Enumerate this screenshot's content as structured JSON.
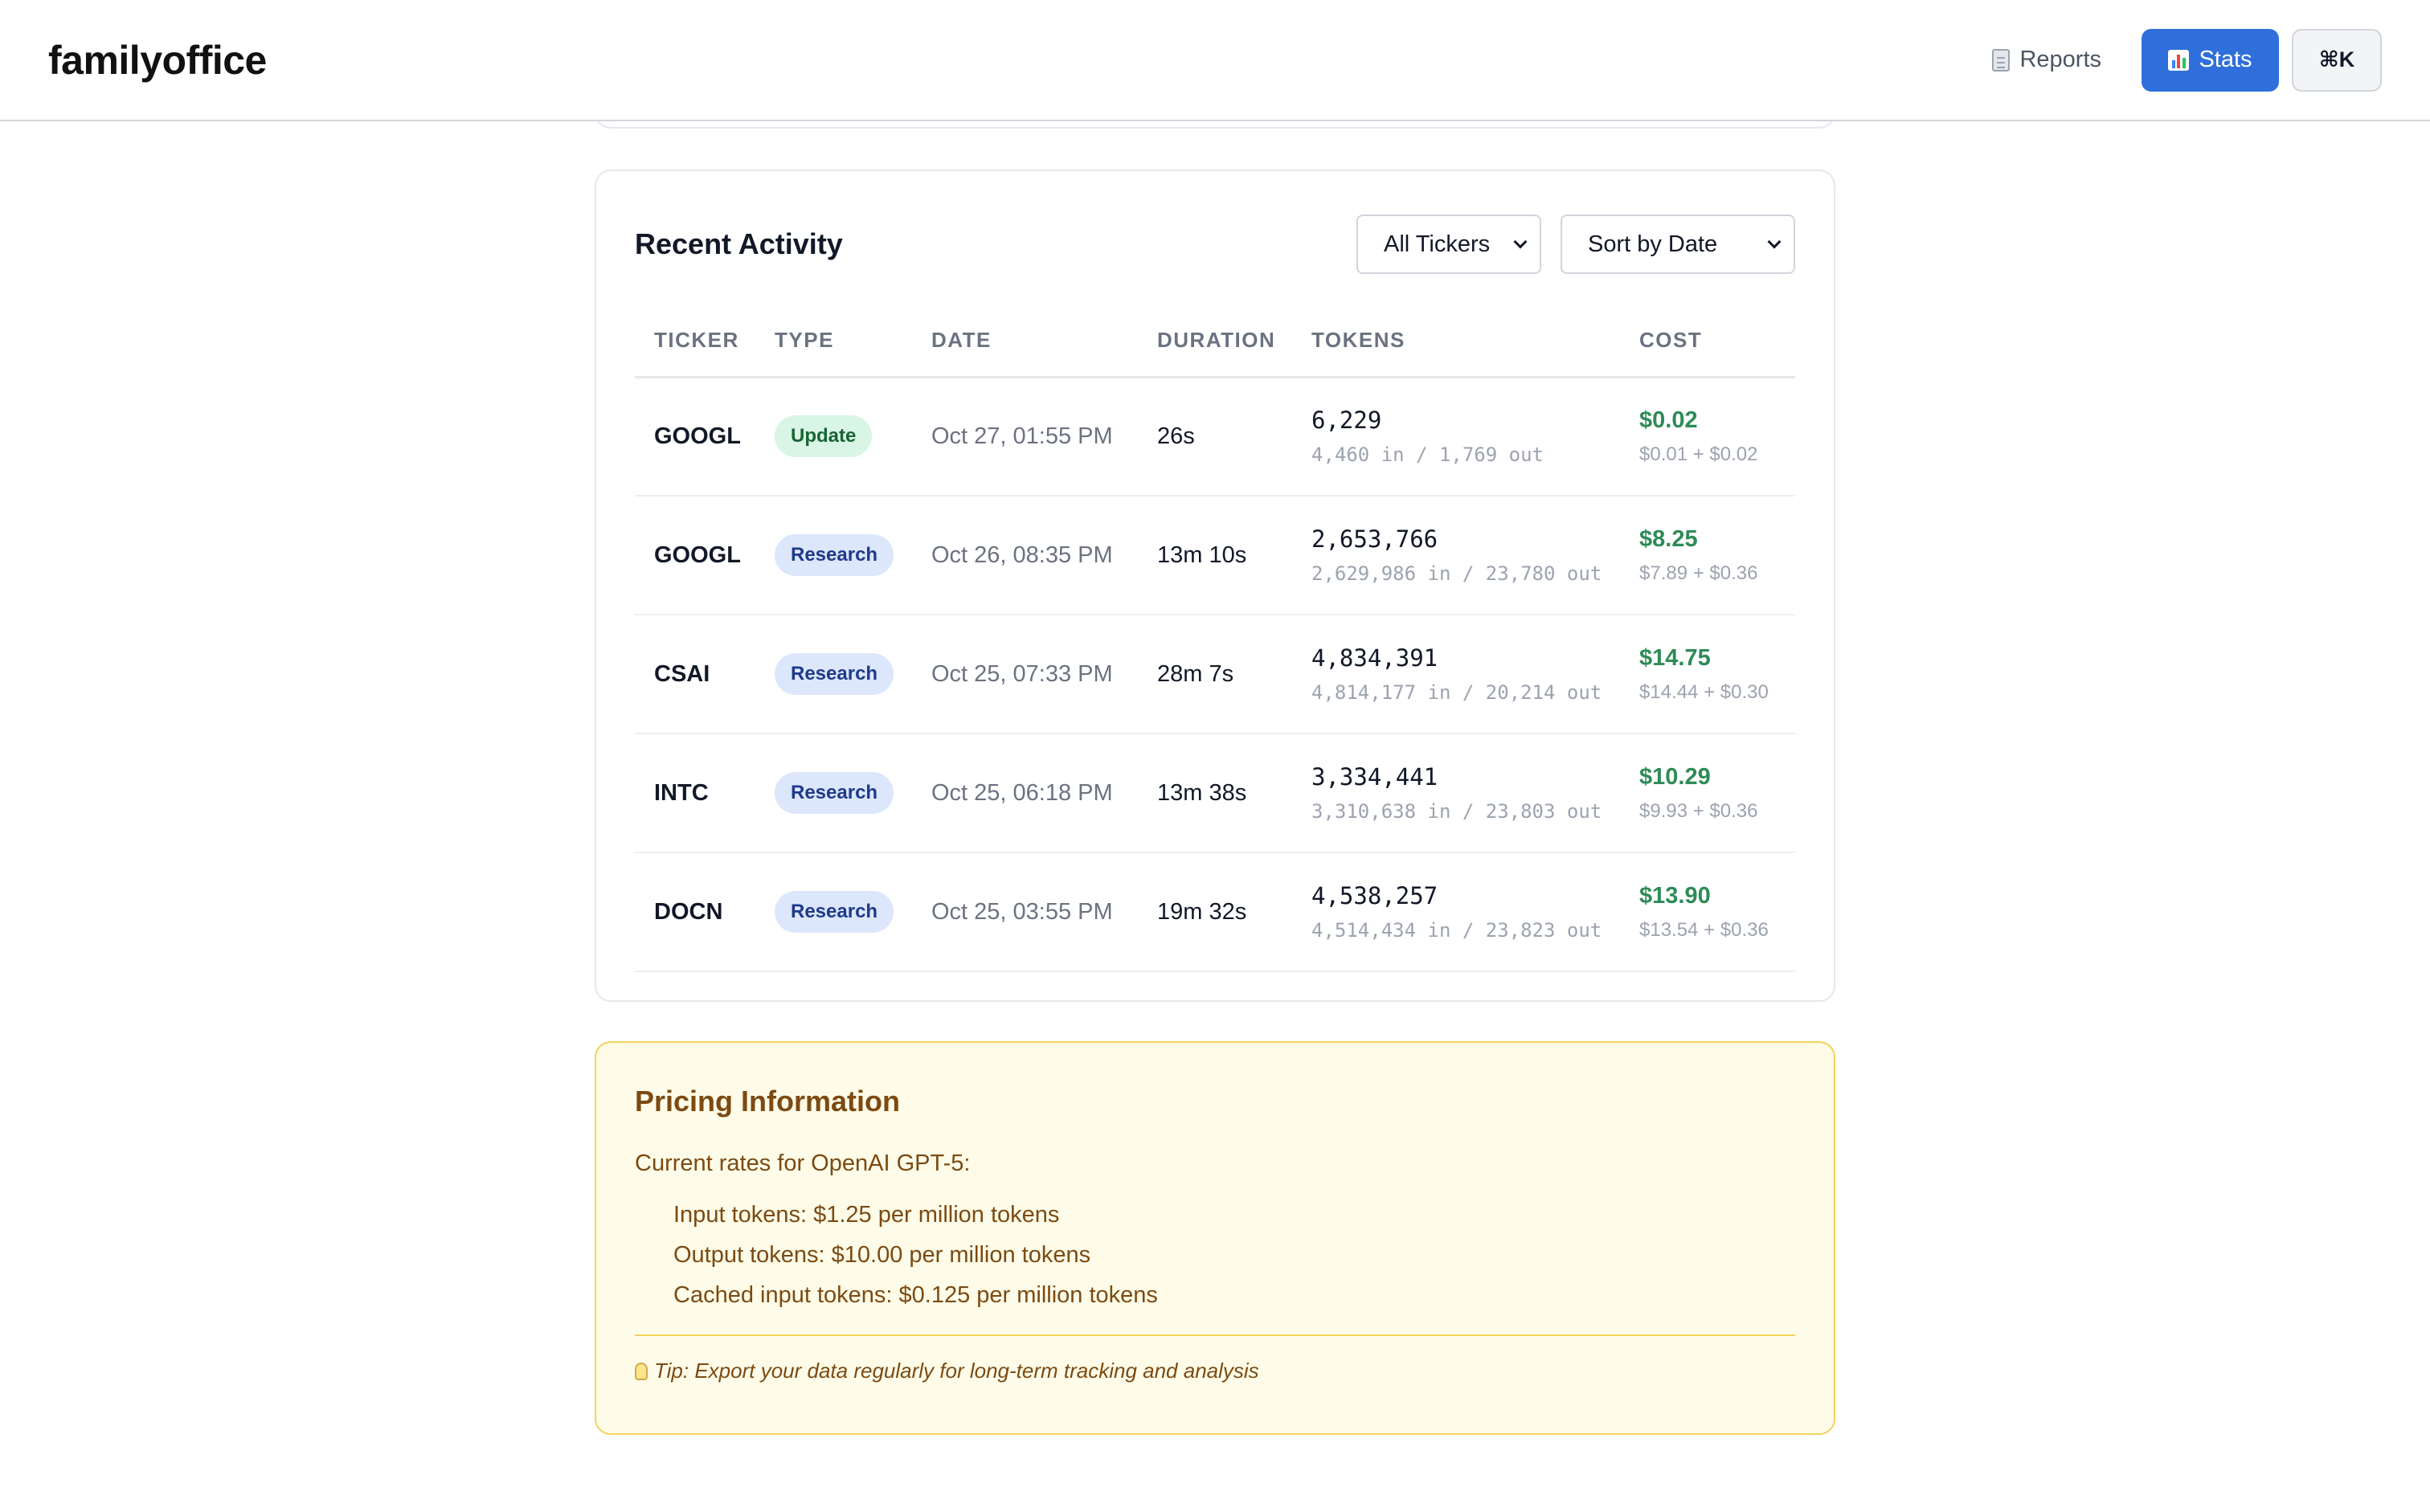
{
  "app": {
    "brand": "familyoffice",
    "nav": {
      "reports_label": "Reports",
      "stats_label": "Stats",
      "shortcut_label": "⌘K"
    }
  },
  "activity": {
    "title": "Recent Activity",
    "filters": {
      "ticker_selected": "All Tickers",
      "sort_selected": "Sort by Date"
    },
    "columns": [
      "TICKER",
      "TYPE",
      "DATE",
      "DURATION",
      "TOKENS",
      "COST"
    ],
    "rows": [
      {
        "ticker": "GOOGL",
        "type": "Update",
        "date": "Oct 27, 01:55 PM",
        "duration": "26s",
        "tokens": "6,229",
        "tokens_detail": "4,460 in / 1,769 out",
        "cost": "$0.02",
        "cost_detail": "$0.01 + $0.02"
      },
      {
        "ticker": "GOOGL",
        "type": "Research",
        "date": "Oct 26, 08:35 PM",
        "duration": "13m 10s",
        "tokens": "2,653,766",
        "tokens_detail": "2,629,986 in / 23,780 out",
        "cost": "$8.25",
        "cost_detail": "$7.89 + $0.36"
      },
      {
        "ticker": "CSAI",
        "type": "Research",
        "date": "Oct 25, 07:33 PM",
        "duration": "28m 7s",
        "tokens": "4,834,391",
        "tokens_detail": "4,814,177 in / 20,214 out",
        "cost": "$14.75",
        "cost_detail": "$14.44 + $0.30"
      },
      {
        "ticker": "INTC",
        "type": "Research",
        "date": "Oct 25, 06:18 PM",
        "duration": "13m 38s",
        "tokens": "3,334,441",
        "tokens_detail": "3,310,638 in / 23,803 out",
        "cost": "$10.29",
        "cost_detail": "$9.93 + $0.36"
      },
      {
        "ticker": "DOCN",
        "type": "Research",
        "date": "Oct 25, 03:55 PM",
        "duration": "19m 32s",
        "tokens": "4,538,257",
        "tokens_detail": "4,514,434 in / 23,823 out",
        "cost": "$13.90",
        "cost_detail": "$13.54 + $0.36"
      }
    ]
  },
  "pricing": {
    "title": "Pricing Information",
    "intro": "Current rates for OpenAI GPT-5:",
    "rates": [
      "Input tokens: $1.25 per million tokens",
      "Output tokens: $10.00 per million tokens",
      "Cached input tokens: $0.125 per million tokens"
    ],
    "tip": "Tip: Export your data regularly for long-term tracking and analysis"
  },
  "icons": {
    "reports": "document-icon",
    "stats": "bar-chart-icon",
    "tip": "lightbulb-icon",
    "select": "chevron-down-icon"
  },
  "colors": {
    "accent": "#2f6fdc",
    "cost_green": "#2e8b57",
    "update_badge_bg": "#d9f5e5",
    "research_badge_bg": "#dde7fb",
    "pricing_bg": "#fefce8",
    "pricing_border": "#f3d25a"
  }
}
